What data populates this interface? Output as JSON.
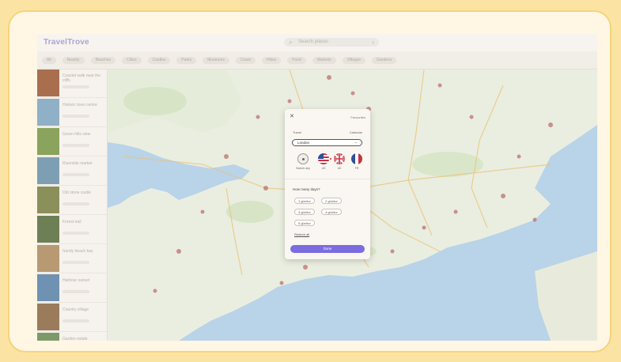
{
  "app": {
    "logo": "TravelTrove",
    "search_placeholder": "Search places"
  },
  "filters": [
    "All",
    "Nearby",
    "Beaches",
    "Cities",
    "Castles",
    "Parks",
    "Museums",
    "Coast",
    "Hikes",
    "Food",
    "Markets",
    "Villages",
    "Gardens"
  ],
  "sidebar": {
    "cards": [
      {
        "title": "Coastal walk near the cliffs",
        "color": "#a96e4e"
      },
      {
        "title": "Historic town centre",
        "color": "#8fb0c7"
      },
      {
        "title": "Green hills view",
        "color": "#8aa35d"
      },
      {
        "title": "Riverside market",
        "color": "#7e9fb3"
      },
      {
        "title": "Old stone castle",
        "color": "#8b8f5a"
      },
      {
        "title": "Forest trail",
        "color": "#6d7f55"
      },
      {
        "title": "Sandy beach bay",
        "color": "#b79a72"
      },
      {
        "title": "Harbour sunset",
        "color": "#6f91b2"
      },
      {
        "title": "Country village",
        "color": "#9a7b5c"
      },
      {
        "title": "Garden estate",
        "color": "#7c9a69"
      }
    ]
  },
  "modal": {
    "close": "✕",
    "favourites": "Favourites",
    "section_left": "Travel",
    "section_right": "Calendar",
    "select_value": "London",
    "flags": [
      {
        "label": "Search any"
      },
      {
        "label": "US"
      },
      {
        "label": "UK"
      },
      {
        "label": "FR"
      }
    ],
    "question": "How many days?",
    "chips": [
      "1 gün/tur",
      "2 gün/tur",
      "3 gün/tur",
      "4 gün/tur",
      "5 gün/tur"
    ],
    "more": "Restore all",
    "submit": "Done"
  }
}
